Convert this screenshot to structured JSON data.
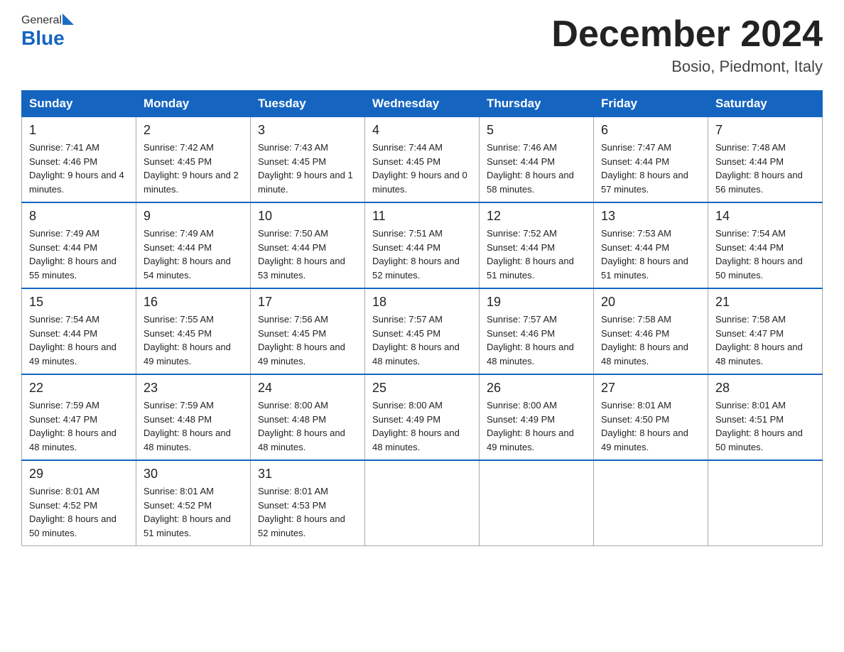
{
  "logo": {
    "general": "General",
    "blue": "Blue"
  },
  "title": "December 2024",
  "location": "Bosio, Piedmont, Italy",
  "headers": [
    "Sunday",
    "Monday",
    "Tuesday",
    "Wednesday",
    "Thursday",
    "Friday",
    "Saturday"
  ],
  "weeks": [
    [
      {
        "day": "1",
        "sunrise": "7:41 AM",
        "sunset": "4:46 PM",
        "daylight": "9 hours and 4 minutes."
      },
      {
        "day": "2",
        "sunrise": "7:42 AM",
        "sunset": "4:45 PM",
        "daylight": "9 hours and 2 minutes."
      },
      {
        "day": "3",
        "sunrise": "7:43 AM",
        "sunset": "4:45 PM",
        "daylight": "9 hours and 1 minute."
      },
      {
        "day": "4",
        "sunrise": "7:44 AM",
        "sunset": "4:45 PM",
        "daylight": "9 hours and 0 minutes."
      },
      {
        "day": "5",
        "sunrise": "7:46 AM",
        "sunset": "4:44 PM",
        "daylight": "8 hours and 58 minutes."
      },
      {
        "day": "6",
        "sunrise": "7:47 AM",
        "sunset": "4:44 PM",
        "daylight": "8 hours and 57 minutes."
      },
      {
        "day": "7",
        "sunrise": "7:48 AM",
        "sunset": "4:44 PM",
        "daylight": "8 hours and 56 minutes."
      }
    ],
    [
      {
        "day": "8",
        "sunrise": "7:49 AM",
        "sunset": "4:44 PM",
        "daylight": "8 hours and 55 minutes."
      },
      {
        "day": "9",
        "sunrise": "7:49 AM",
        "sunset": "4:44 PM",
        "daylight": "8 hours and 54 minutes."
      },
      {
        "day": "10",
        "sunrise": "7:50 AM",
        "sunset": "4:44 PM",
        "daylight": "8 hours and 53 minutes."
      },
      {
        "day": "11",
        "sunrise": "7:51 AM",
        "sunset": "4:44 PM",
        "daylight": "8 hours and 52 minutes."
      },
      {
        "day": "12",
        "sunrise": "7:52 AM",
        "sunset": "4:44 PM",
        "daylight": "8 hours and 51 minutes."
      },
      {
        "day": "13",
        "sunrise": "7:53 AM",
        "sunset": "4:44 PM",
        "daylight": "8 hours and 51 minutes."
      },
      {
        "day": "14",
        "sunrise": "7:54 AM",
        "sunset": "4:44 PM",
        "daylight": "8 hours and 50 minutes."
      }
    ],
    [
      {
        "day": "15",
        "sunrise": "7:54 AM",
        "sunset": "4:44 PM",
        "daylight": "8 hours and 49 minutes."
      },
      {
        "day": "16",
        "sunrise": "7:55 AM",
        "sunset": "4:45 PM",
        "daylight": "8 hours and 49 minutes."
      },
      {
        "day": "17",
        "sunrise": "7:56 AM",
        "sunset": "4:45 PM",
        "daylight": "8 hours and 49 minutes."
      },
      {
        "day": "18",
        "sunrise": "7:57 AM",
        "sunset": "4:45 PM",
        "daylight": "8 hours and 48 minutes."
      },
      {
        "day": "19",
        "sunrise": "7:57 AM",
        "sunset": "4:46 PM",
        "daylight": "8 hours and 48 minutes."
      },
      {
        "day": "20",
        "sunrise": "7:58 AM",
        "sunset": "4:46 PM",
        "daylight": "8 hours and 48 minutes."
      },
      {
        "day": "21",
        "sunrise": "7:58 AM",
        "sunset": "4:47 PM",
        "daylight": "8 hours and 48 minutes."
      }
    ],
    [
      {
        "day": "22",
        "sunrise": "7:59 AM",
        "sunset": "4:47 PM",
        "daylight": "8 hours and 48 minutes."
      },
      {
        "day": "23",
        "sunrise": "7:59 AM",
        "sunset": "4:48 PM",
        "daylight": "8 hours and 48 minutes."
      },
      {
        "day": "24",
        "sunrise": "8:00 AM",
        "sunset": "4:48 PM",
        "daylight": "8 hours and 48 minutes."
      },
      {
        "day": "25",
        "sunrise": "8:00 AM",
        "sunset": "4:49 PM",
        "daylight": "8 hours and 48 minutes."
      },
      {
        "day": "26",
        "sunrise": "8:00 AM",
        "sunset": "4:49 PM",
        "daylight": "8 hours and 49 minutes."
      },
      {
        "day": "27",
        "sunrise": "8:01 AM",
        "sunset": "4:50 PM",
        "daylight": "8 hours and 49 minutes."
      },
      {
        "day": "28",
        "sunrise": "8:01 AM",
        "sunset": "4:51 PM",
        "daylight": "8 hours and 50 minutes."
      }
    ],
    [
      {
        "day": "29",
        "sunrise": "8:01 AM",
        "sunset": "4:52 PM",
        "daylight": "8 hours and 50 minutes."
      },
      {
        "day": "30",
        "sunrise": "8:01 AM",
        "sunset": "4:52 PM",
        "daylight": "8 hours and 51 minutes."
      },
      {
        "day": "31",
        "sunrise": "8:01 AM",
        "sunset": "4:53 PM",
        "daylight": "8 hours and 52 minutes."
      },
      null,
      null,
      null,
      null
    ]
  ]
}
